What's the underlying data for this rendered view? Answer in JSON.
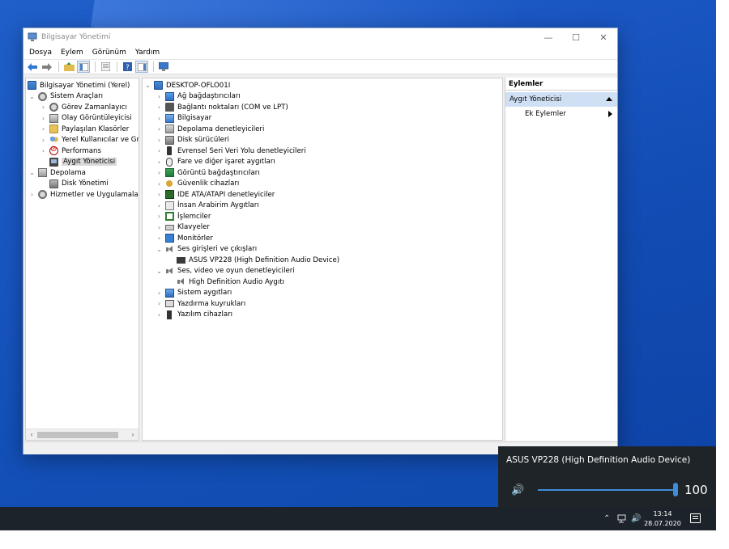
{
  "window": {
    "title": "Bilgisayar Yönetimi",
    "minimize": "—",
    "maximize": "☐",
    "close": "✕"
  },
  "menu": [
    "Dosya",
    "Eylem",
    "Görünüm",
    "Yardım"
  ],
  "left_tree": {
    "root": "Bilgisayar Yönetimi (Yerel)",
    "system_tools": "Sistem Araçları",
    "task_scheduler": "Görev Zamanlayıcı",
    "event_viewer": "Olay Görüntüleyicisi",
    "shared_folders": "Paylaşılan Klasörler",
    "local_users": "Yerel Kullanıcılar ve Gru",
    "performance": "Performans",
    "device_manager": "Aygıt Yöneticisi",
    "storage": "Depolama",
    "disk_management": "Disk Yönetimi",
    "services": "Hizmetler ve Uygulamalar"
  },
  "device_tree": {
    "root": "DESKTOP-OFLO01I",
    "items": [
      "Ağ bağdaştırıcıları",
      "Bağlantı noktaları (COM ve LPT)",
      "Bilgisayar",
      "Depolama denetleyicileri",
      "Disk sürücüleri",
      "Evrensel Seri Veri Yolu denetleyicileri",
      "Fare ve diğer işaret aygıtları",
      "Görüntü bağdaştırıcıları",
      "Güvenlik cihazları",
      "IDE ATA/ATAPI denetleyiciler",
      "İnsan Arabirim Aygıtları",
      "İşlemciler",
      "Klavyeler",
      "Monitörler",
      "Ses girişleri ve çıkışları",
      "ASUS VP228 (High Definition Audio Device)",
      "Ses, video ve oyun denetleyicileri",
      "High Definition Audio Aygıtı",
      "Sistem aygıtları",
      "Yazdırma kuyrukları",
      "Yazılım cihazları"
    ]
  },
  "actions": {
    "header": "Eylemler",
    "selected": "Aygıt Yöneticisi",
    "more": "Ek Eylemler"
  },
  "volume": {
    "device": "ASUS VP228 (High Definition Audio Device)",
    "level": 100,
    "level_label": "100",
    "speaker_glyph": "🔊",
    "accent": "#3f8cd8"
  },
  "taskbar": {
    "time": "13:14",
    "date": "28.07.2020",
    "chevron": "⌃",
    "network_glyph": "🖧",
    "volume_glyph": "🔊"
  },
  "colors": {
    "desktop_blue": "#1a56c2",
    "selection": "#cfe0f5",
    "flyout_bg": "#1f2429"
  }
}
